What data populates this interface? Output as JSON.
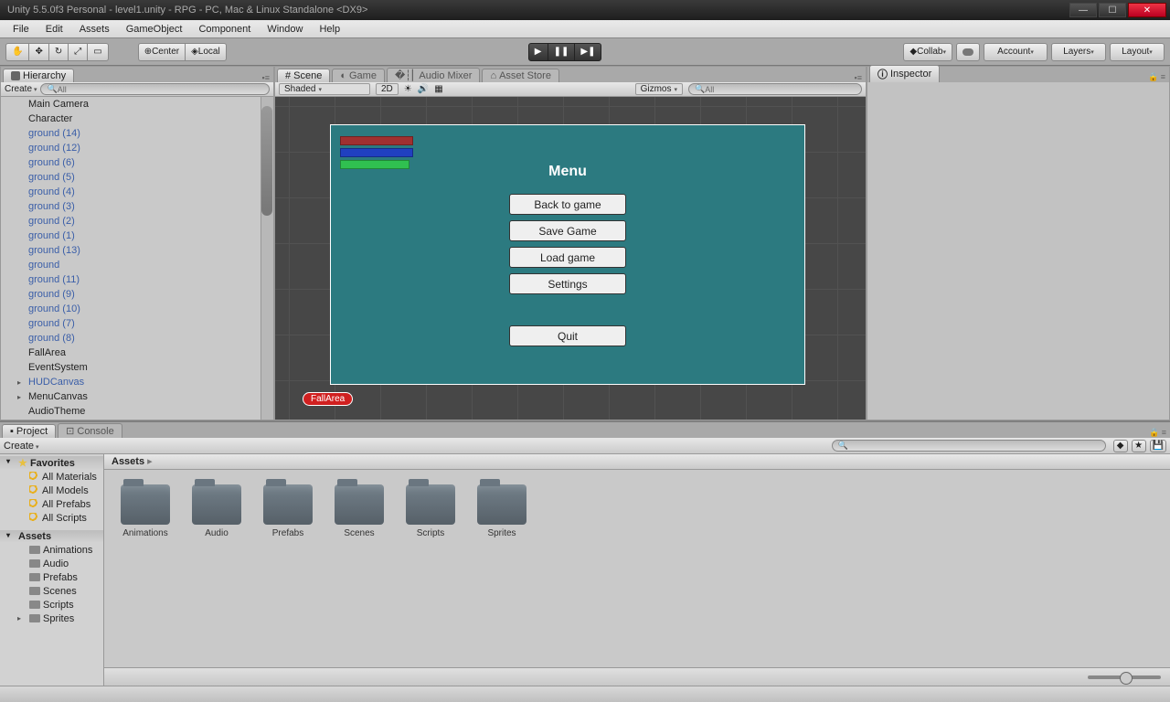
{
  "titlebar": {
    "title": "Unity 5.5.0f3 Personal - level1.unity - RPG - PC, Mac & Linux Standalone <DX9>"
  },
  "menubar": [
    "File",
    "Edit",
    "Assets",
    "GameObject",
    "Component",
    "Window",
    "Help"
  ],
  "toolbar": {
    "center": "Center",
    "local": "Local",
    "collab": "Collab",
    "account": "Account",
    "layers": "Layers",
    "layout": "Layout"
  },
  "hierarchy": {
    "tab": "Hierarchy",
    "create": "Create",
    "search_placeholder": "All",
    "items": [
      {
        "label": "Main Camera",
        "prefab": false
      },
      {
        "label": "Character",
        "prefab": false
      },
      {
        "label": "ground (14)",
        "prefab": true
      },
      {
        "label": "ground (12)",
        "prefab": true
      },
      {
        "label": "ground (6)",
        "prefab": true
      },
      {
        "label": "ground (5)",
        "prefab": true
      },
      {
        "label": "ground (4)",
        "prefab": true
      },
      {
        "label": "ground (3)",
        "prefab": true
      },
      {
        "label": "ground (2)",
        "prefab": true
      },
      {
        "label": "ground (1)",
        "prefab": true
      },
      {
        "label": "ground (13)",
        "prefab": true
      },
      {
        "label": "ground",
        "prefab": true
      },
      {
        "label": "ground (11)",
        "prefab": true
      },
      {
        "label": "ground (9)",
        "prefab": true
      },
      {
        "label": "ground (10)",
        "prefab": true
      },
      {
        "label": "ground (7)",
        "prefab": true
      },
      {
        "label": "ground (8)",
        "prefab": true
      },
      {
        "label": "FallArea",
        "prefab": false
      },
      {
        "label": "EventSystem",
        "prefab": false
      },
      {
        "label": "HUDCanvas",
        "prefab": true,
        "arrow": true
      },
      {
        "label": "MenuCanvas",
        "prefab": false,
        "arrow": true
      },
      {
        "label": "AudioTheme",
        "prefab": false
      }
    ]
  },
  "center_tabs": {
    "scene": "Scene",
    "game": "Game",
    "audio_mixer": "Audio Mixer",
    "asset_store": "Asset Store"
  },
  "scene_sub": {
    "shaded": "Shaded",
    "twod": "2D",
    "gizmos": "Gizmos",
    "search_placeholder": "All"
  },
  "game_menu": {
    "title": "Menu",
    "back": "Back to game",
    "save": "Save Game",
    "load": "Load game",
    "settings": "Settings",
    "quit": "Quit"
  },
  "fallarea_label": "FallArea",
  "inspector": {
    "tab": "Inspector"
  },
  "project": {
    "tab_project": "Project",
    "tab_console": "Console",
    "create": "Create",
    "favorites": "Favorites",
    "fav_items": [
      "All Materials",
      "All Models",
      "All Prefabs",
      "All Scripts"
    ],
    "assets_hdr": "Assets",
    "tree_items": [
      "Animations",
      "Audio",
      "Prefabs",
      "Scenes",
      "Scripts",
      "Sprites"
    ],
    "crumb": "Assets",
    "folders": [
      "Animations",
      "Audio",
      "Prefabs",
      "Scenes",
      "Scripts",
      "Sprites"
    ]
  }
}
